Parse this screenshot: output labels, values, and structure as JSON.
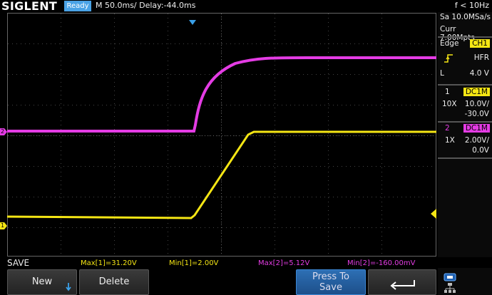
{
  "header": {
    "logo": "SIGLENT",
    "status": "Ready",
    "timebase": "M 50.0ms/ Delay:-44.0ms",
    "frequency": "f < 10Hz"
  },
  "acquisition": {
    "sample_rate": "Sa 10.0MSa/s",
    "memory": "Curr 7.00Mpts"
  },
  "trigger": {
    "type": "Edge",
    "source": "CH1",
    "coupling": "HFR",
    "level_label": "L",
    "level": "4.0 V"
  },
  "channels": [
    {
      "number": "1",
      "coupling": "DC1M",
      "probe": "10X",
      "scale": "10.0V/",
      "offset": "-30.0V",
      "color": "#f5e614"
    },
    {
      "number": "2",
      "coupling": "DC1M",
      "probe": "1X",
      "scale": "2.00V/",
      "offset": "0.0V",
      "color": "#e43ce4"
    }
  ],
  "markers": {
    "ch1": "1",
    "ch2": "2"
  },
  "measurements": {
    "title": "SAVE",
    "items": [
      {
        "text": "Max[1]=31.20V",
        "channel": 1
      },
      {
        "text": "Min[1]=2.00V",
        "channel": 1
      },
      {
        "text": "Max[2]=5.12V",
        "channel": 2
      },
      {
        "text": "Min[2]=-160.00mV",
        "channel": 2
      }
    ]
  },
  "softkeys": {
    "new_label": "New",
    "delete_label": "Delete",
    "press_to_save_line1": "Press To",
    "press_to_save_line2": "Save"
  },
  "icons": {
    "new_arrow": "arrow-down-icon",
    "return": "return-arrow-icon",
    "usb_network": "network-icon"
  }
}
